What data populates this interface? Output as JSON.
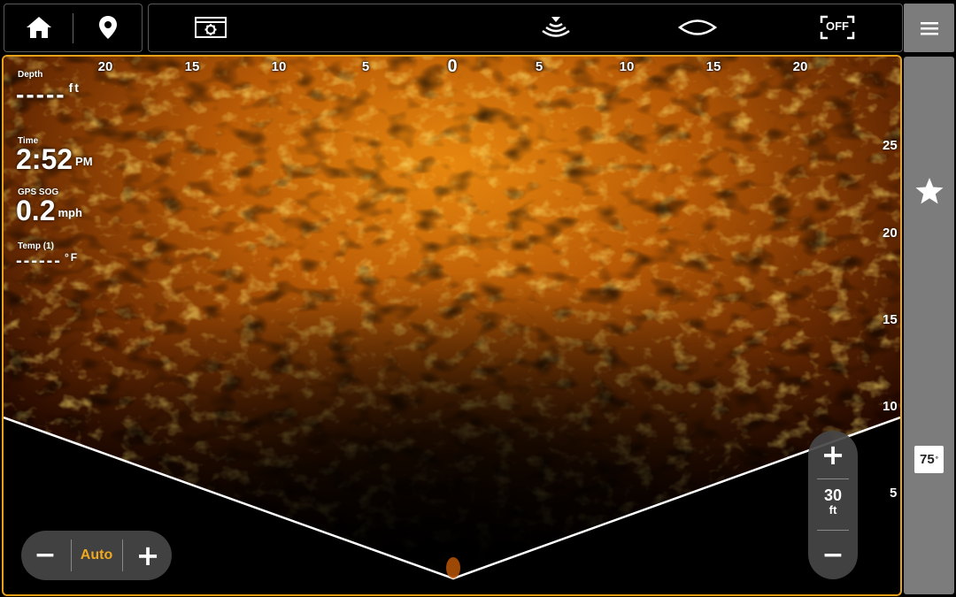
{
  "topbar": {
    "icons": [
      "home-icon",
      "waypoint-pin-icon",
      "settings-screen-icon",
      "sonar-ping-icon",
      "coverage-eye-icon",
      "off-frame-icon",
      "menu-icon"
    ],
    "off_label": "OFF"
  },
  "sonar": {
    "top_scale": [
      "20",
      "15",
      "10",
      "5",
      "0",
      "5",
      "10",
      "15",
      "20"
    ],
    "right_scale": [
      "25",
      "20",
      "15",
      "10",
      "5"
    ],
    "accent_color": "#e8a21a",
    "beam_line_color": "#ffffff"
  },
  "readouts": {
    "depth": {
      "label": "Depth",
      "value": "-----",
      "unit": "ft"
    },
    "time": {
      "label": "Time",
      "value": "2:52",
      "unit": "PM"
    },
    "sog": {
      "label": "GPS SOG",
      "value": "0.2",
      "unit": "mph"
    },
    "temp": {
      "label": "Temp (1)",
      "value": "------",
      "unit": "°F"
    }
  },
  "gain": {
    "minus": "−",
    "mode": "Auto",
    "plus": "+"
  },
  "zoom": {
    "plus": "+",
    "range_value": "30",
    "range_unit": "ft",
    "minus": "−"
  },
  "sidebar": {
    "favorite_icon": "star-icon",
    "temp_badge": "75",
    "temp_badge_unit": "°"
  }
}
